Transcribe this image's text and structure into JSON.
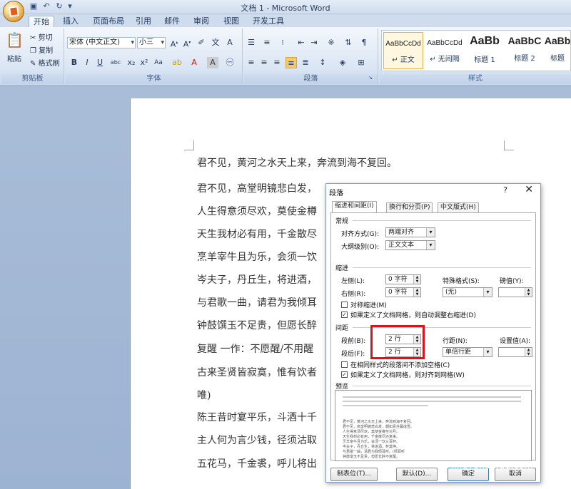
{
  "window": {
    "title": "文档 1 - Microsoft Word"
  },
  "qat": [
    "save-icon",
    "undo-icon",
    "redo-icon"
  ],
  "tabs": [
    "开始",
    "插入",
    "页面布局",
    "引用",
    "邮件",
    "审阅",
    "视图",
    "开发工具"
  ],
  "clipboard": {
    "paste": "粘贴",
    "cut": "剪切",
    "copy": "复制",
    "format_painter": "格式刷",
    "label": "剪贴板"
  },
  "font": {
    "name": "宋体 (中文正文)",
    "size": "小三",
    "label": "字体"
  },
  "paragraph": {
    "label": "段落"
  },
  "styles": {
    "label": "样式",
    "items": [
      {
        "preview": "AaBbCcDd",
        "name": "↵ 正文"
      },
      {
        "preview": "AaBbCcDd",
        "name": "↵ 无间隔"
      },
      {
        "preview": "AaBb",
        "name": "标题 1"
      },
      {
        "preview": "AaBbC",
        "name": "标题 2"
      },
      {
        "preview": "AaBb",
        "name": "标题"
      }
    ]
  },
  "document": {
    "lines": [
      "君不见，黄河之水天上来，奔流到海不复回。",
      "君不见，高堂明镜悲白发，",
      "人生得意须尽欢，莫使金樽",
      "天生我材必有用，千金散尽",
      "烹羊宰牛且为乐，会须一饮",
      "岑夫子，丹丘生，将进酒，",
      "与君歌一曲，请君为我倾耳",
      "钟鼓馔玉不足贵，但愿长醉",
      "复醒 一作：不愿醒/不用醒",
      "古来圣贤皆寂寞，惟有饮者",
      "唯)",
      "陈王昔时宴平乐，斗酒十千",
      "主人何为言少钱，径须沽取",
      "五花马，千金裘，呼儿将出"
    ]
  },
  "dialog": {
    "title": "段落",
    "help": "?",
    "close": "✕",
    "tabs": [
      "缩进和间距(I)",
      "换行和分页(P)",
      "中文版式(H)"
    ],
    "general": {
      "heading": "常规",
      "alignment_label": "对齐方式(G):",
      "alignment_value": "两端对齐",
      "outline_label": "大纲级别(O):",
      "outline_value": "正文文本"
    },
    "indent": {
      "heading": "缩进",
      "left_label": "左侧(L):",
      "left_value": "0 字符",
      "right_label": "右侧(R):",
      "right_value": "0 字符",
      "special_label": "特殊格式(S):",
      "special_value": "(无)",
      "by_label": "磅值(Y):",
      "by_value": "",
      "mirror": "对称缩进(M)",
      "auto_adjust": "如果定义了文档网格，则自动调整右缩进(D)"
    },
    "spacing": {
      "heading": "间距",
      "before_label": "段前(B):",
      "before_value": "2 行",
      "after_label": "段后(F):",
      "after_value": "2 行",
      "line_label": "行距(N):",
      "line_value": "单倍行距",
      "at_label": "设置值(A):",
      "at_value": "",
      "no_space": "在相同样式的段落间不添加空格(C)",
      "snap_grid": "如果定义了文档网格，则对齐到网格(W)"
    },
    "preview": {
      "heading": "预览",
      "lines": [
        "君不见，黄河之水天上来，奔流到海不复回。",
        "君不见，高堂明镜悲白发，朝如青丝暮成雪。",
        "人生得意须尽欢，莫使金樽空对月。",
        "天生我材必有用，千金散尽还复来。",
        "烹羊宰牛且为乐，会须一饮三百杯。",
        "岑夫子，丹丘生，将进酒，杯莫停。",
        "与君歌一曲，请君为我倾耳听。(倾耳听",
        "钟鼓馔玉不足贵，但愿长醉不复醒。"
      ]
    },
    "buttons": {
      "tabs": "制表位(T)...",
      "default": "默认(D)...",
      "ok": "确定",
      "cancel": "取消"
    }
  },
  "watermark": "jingyanbaidu.com"
}
